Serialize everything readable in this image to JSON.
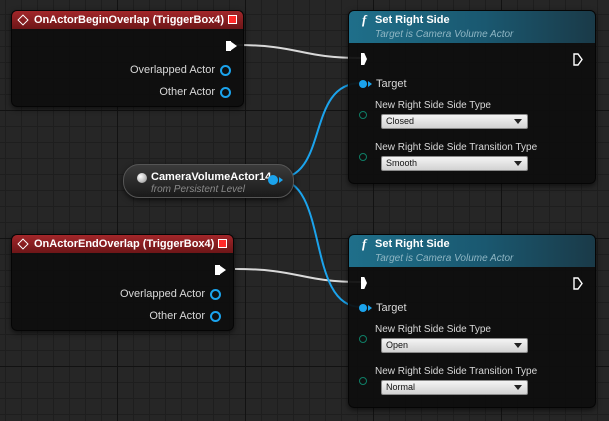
{
  "events": [
    {
      "title": "OnActorBeginOverlap (TriggerBox4)",
      "pins": [
        "Overlapped Actor",
        "Other Actor"
      ]
    },
    {
      "title": "OnActorEndOverlap (TriggerBox4)",
      "pins": [
        "Overlapped Actor",
        "Other Actor"
      ]
    }
  ],
  "functions": [
    {
      "title": "Set Right Side",
      "subtitle": "Target is Camera Volume Actor",
      "target_label": "Target",
      "param1_label": "New Right Side Side Type",
      "param1_value": "Closed",
      "param2_label": "New Right Side Side Transition Type",
      "param2_value": "Smooth"
    },
    {
      "title": "Set Right Side",
      "subtitle": "Target is Camera Volume Actor",
      "target_label": "Target",
      "param1_label": "New Right Side Side Type",
      "param1_value": "Open",
      "param2_label": "New Right Side Side Transition Type",
      "param2_value": "Normal"
    }
  ],
  "variable": {
    "name": "CameraVolumeActor14",
    "subtitle": "from Persistent Level"
  },
  "icons": {
    "function": "f",
    "event": "diamond-icon",
    "close": "close-icon"
  },
  "colors": {
    "canvas": "#262626",
    "event_header": "#a2262a",
    "function_header": "#1f6f8a",
    "object_pin": "#1ba3ec",
    "enum_pin": "#0e7e66",
    "exec_wire": "#ffffff"
  }
}
